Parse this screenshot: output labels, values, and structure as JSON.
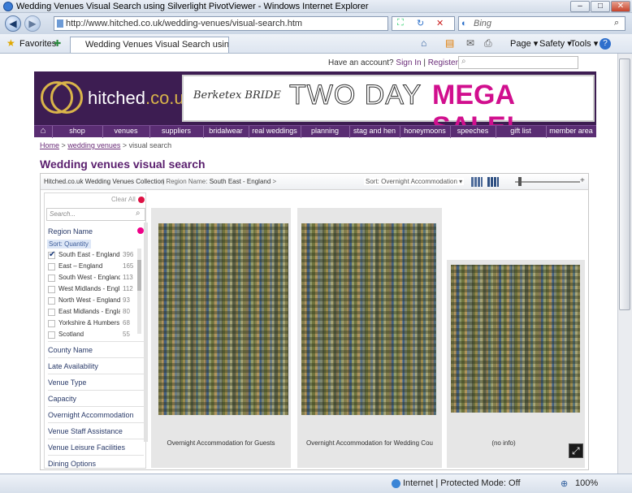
{
  "window": {
    "title": "Wedding Venues Visual Search using Silverlight PivotViewer - Windows Internet Explorer",
    "min": "–",
    "max": "□",
    "close": "✕"
  },
  "address": {
    "url": "http://www.hitched.co.uk/wedding-venues/visual-search.htm",
    "search_placeholder": "Bing",
    "refresh": "↻",
    "stop": "✕"
  },
  "favorites": {
    "label": "Favorites",
    "tab_title": "Wedding Venues Visual Search using Silverlight P...",
    "page": "Page ▾",
    "safety": "Safety ▾",
    "tools": "Tools ▾",
    "help": "?"
  },
  "site": {
    "account_text": "Have an account?",
    "sign_in": "Sign In",
    "register": "Register",
    "logo": "hitched",
    "logo_tld": ".co.uk",
    "banner_brand": "Berketex BRIDE",
    "banner_text1": "TWO DAY ",
    "banner_text2": "MEGA SALE!",
    "nav": [
      "⌂",
      "shop",
      "venues",
      "suppliers",
      "bridalwear",
      "real weddings",
      "planning",
      "stag and hen",
      "honeymoons",
      "speeches",
      "gift list",
      "member area"
    ],
    "breadcrumb": {
      "home": "Home",
      "venues": "wedding venues",
      "current": "> visual search",
      "sep": ">"
    },
    "heading": "Wedding venues visual search"
  },
  "pivot": {
    "collection": "Hitched.co.uk Wedding Venues Collection",
    "region_prefix": "Region Name:",
    "region_value": "South East - England",
    "sort": "Sort: Overnight Accommodation ▾",
    "clear_all": "Clear All",
    "search_placeholder": "Search...",
    "facet_title": "Region Name",
    "sort_quantity": "Sort: Quantity",
    "regions": [
      {
        "label": "South East - England",
        "count": "396",
        "checked": true
      },
      {
        "label": "East – England",
        "count": "165",
        "checked": false
      },
      {
        "label": "South West - England",
        "count": "113",
        "checked": false
      },
      {
        "label": "West Midlands - Engl",
        "count": "112",
        "checked": false
      },
      {
        "label": "North West - England",
        "count": "93",
        "checked": false
      },
      {
        "label": "East Midlands - Engla",
        "count": "80",
        "checked": false
      },
      {
        "label": "Yorkshire & Humbers",
        "count": "68",
        "checked": false
      },
      {
        "label": "Scotland",
        "count": "55",
        "checked": false
      }
    ],
    "facets": [
      "County Name",
      "Late Availability",
      "Venue Type",
      "Capacity",
      "Overnight Accommodation",
      "Venue Staff Assistance",
      "Venue Leisure Facilities",
      "Dining Options"
    ],
    "columns": [
      {
        "label": "Overnight Accommodation for Guests"
      },
      {
        "label": "Overnight Accommodation for Wedding Cou"
      },
      {
        "label": "(no info)"
      }
    ]
  },
  "status": {
    "zone": "Internet | Protected Mode: Off",
    "zoom": "100%"
  }
}
